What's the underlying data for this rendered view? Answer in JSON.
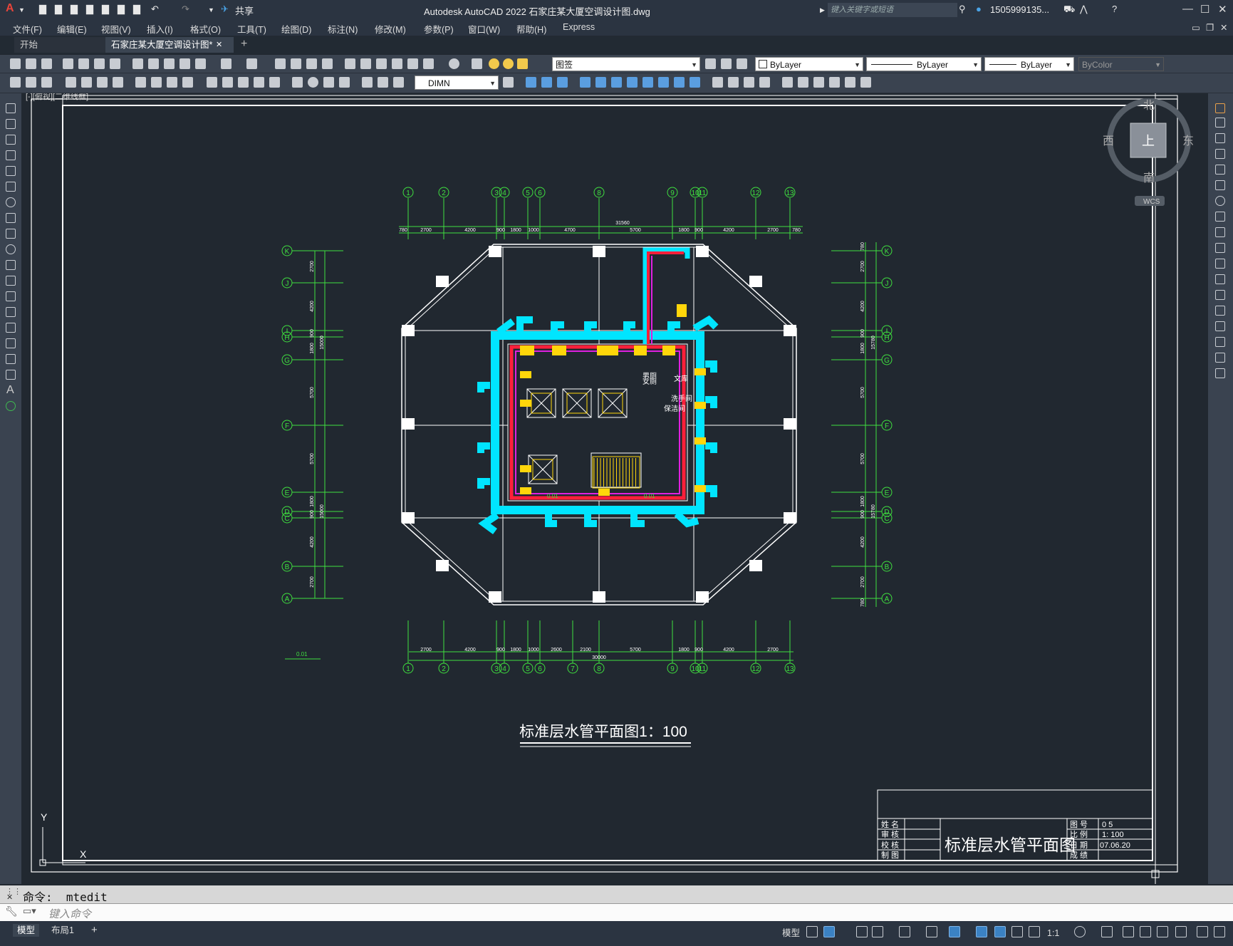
{
  "window": {
    "app_title": "Autodesk AutoCAD 2022    石家庄某大厦空调设计图.dwg",
    "share_label": "共享",
    "search_placeholder": "键入关键字或短语",
    "user_name": "1505999135...",
    "minimize": "—",
    "maximize": "☐",
    "close": "✕"
  },
  "menu": [
    "文件(F)",
    "编辑(E)",
    "视图(V)",
    "插入(I)",
    "格式(O)",
    "工具(T)",
    "绘图(D)",
    "标注(N)",
    "修改(M)",
    "参数(P)",
    "窗口(W)",
    "帮助(H)",
    "Express"
  ],
  "tabs": {
    "start": "开始",
    "file": "石家庄某大厦空调设计图*",
    "close": "✕",
    "add": "+"
  },
  "toolbar": {
    "layer_name": "图签",
    "color": "ByLayer",
    "linetype": "ByLayer",
    "lineweight": "ByLayer",
    "plotstyle": "ByColor",
    "dimstyle": "DIMN"
  },
  "viewcube": {
    "north": "北",
    "south": "南",
    "east": "东",
    "west": "西",
    "top": "上",
    "wcs": "WCS"
  },
  "viewport_label": "[-][俯视][二维线框]",
  "drawing": {
    "top_axes": [
      "1",
      "2",
      "3",
      "4",
      "5",
      "6",
      "8",
      "9",
      "10",
      "11",
      "12",
      "13"
    ],
    "bottom_axes": [
      "1",
      "2",
      "3",
      "4",
      "5",
      "6",
      "7",
      "8",
      "9",
      "10",
      "11",
      "12",
      "13"
    ],
    "left_axes": [
      "K",
      "J",
      "I",
      "H",
      "G",
      "F",
      "E",
      "D",
      "C",
      "B",
      "A"
    ],
    "top_dims": [
      "780",
      "2700",
      "4200",
      "900",
      "1800",
      "1000",
      "4700",
      "5700",
      "1800",
      "900",
      "4200",
      "2700",
      "780"
    ],
    "top_total": "31560",
    "bottom_dims": [
      "2700",
      "4200",
      "900",
      "1800",
      "1000",
      "2600",
      "2100",
      "5700",
      "1800",
      "900",
      "4200",
      "2700"
    ],
    "bottom_total": "30000",
    "left_dims": [
      "2700",
      "4200",
      "900",
      "1800",
      "5700",
      "5700",
      "1800",
      "900",
      "4200",
      "2700"
    ],
    "left_totals": [
      "15000",
      "15000"
    ],
    "right_dims": [
      "780",
      "2700",
      "4200",
      "900",
      "1800",
      "5700",
      "5700",
      "1800",
      "900",
      "4200",
      "2700",
      "780"
    ],
    "right_totals": [
      "15780",
      "15780"
    ],
    "room_labels": [
      "文库",
      "洗手间",
      "保洁间",
      "男厕",
      "女厕"
    ],
    "slope_labels": [
      "0.01",
      "0.01",
      "0.01"
    ],
    "drawing_title": "标准层水管平面图1：100",
    "titleblock": {
      "left_labels": [
        "姓  名",
        "审  核",
        "校  核",
        "制  图"
      ],
      "main_title": "标准层水管平面图",
      "right_labels": [
        "图  号",
        "比  例",
        "日  期",
        "成  绩"
      ],
      "right_values": [
        "0 5",
        "1: 100",
        "07.06.20",
        ""
      ]
    },
    "ucs_x": "X",
    "ucs_y": "Y"
  },
  "command": {
    "history": "命令: _mtedit",
    "placeholder": "键入命令"
  },
  "status": {
    "model": "模型",
    "layout": "布局1",
    "add": "+",
    "model_space": "模型",
    "scale": "1:1"
  }
}
